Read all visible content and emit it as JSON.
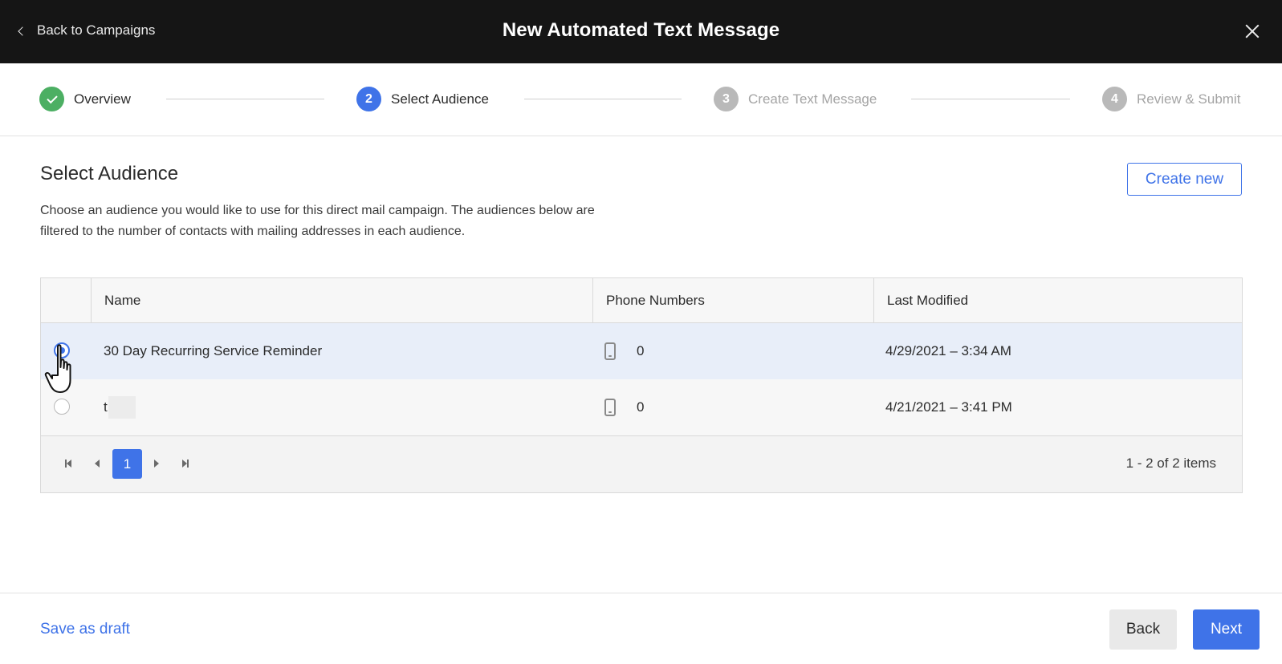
{
  "header": {
    "back_label": "Back to Campaigns",
    "title": "New Automated Text Message",
    "close_icon": "close-icon"
  },
  "stepper": {
    "steps": [
      {
        "number": "1",
        "label": "Overview",
        "state": "done"
      },
      {
        "number": "2",
        "label": "Select Audience",
        "state": "active"
      },
      {
        "number": "3",
        "label": "Create Text Message",
        "state": "future"
      },
      {
        "number": "4",
        "label": "Review & Submit",
        "state": "future"
      }
    ]
  },
  "main": {
    "title": "Select Audience",
    "description": "Choose an audience you would like to use for this direct mail campaign. The audiences below are filtered to the number of contacts with mailing addresses in each audience.",
    "create_new_label": "Create new"
  },
  "table": {
    "columns": [
      "Name",
      "Phone Numbers",
      "Last Modified"
    ],
    "rows": [
      {
        "name": "30 Day Recurring Service Reminder",
        "phone_numbers": "0",
        "last_modified": "4/29/2021 – 3:34 AM",
        "selected": true
      },
      {
        "name": "t",
        "phone_numbers": "0",
        "last_modified": "4/21/2021 – 3:41 PM",
        "selected": false
      }
    ],
    "pager": {
      "current_page": "1",
      "info": "1 - 2 of 2 items"
    }
  },
  "footer": {
    "save_draft_label": "Save as draft",
    "back_label": "Back",
    "next_label": "Next"
  },
  "colors": {
    "accent": "#3f73e8",
    "success": "#4caf63",
    "header_bg": "#151515",
    "selected_row": "#e8eef9"
  }
}
